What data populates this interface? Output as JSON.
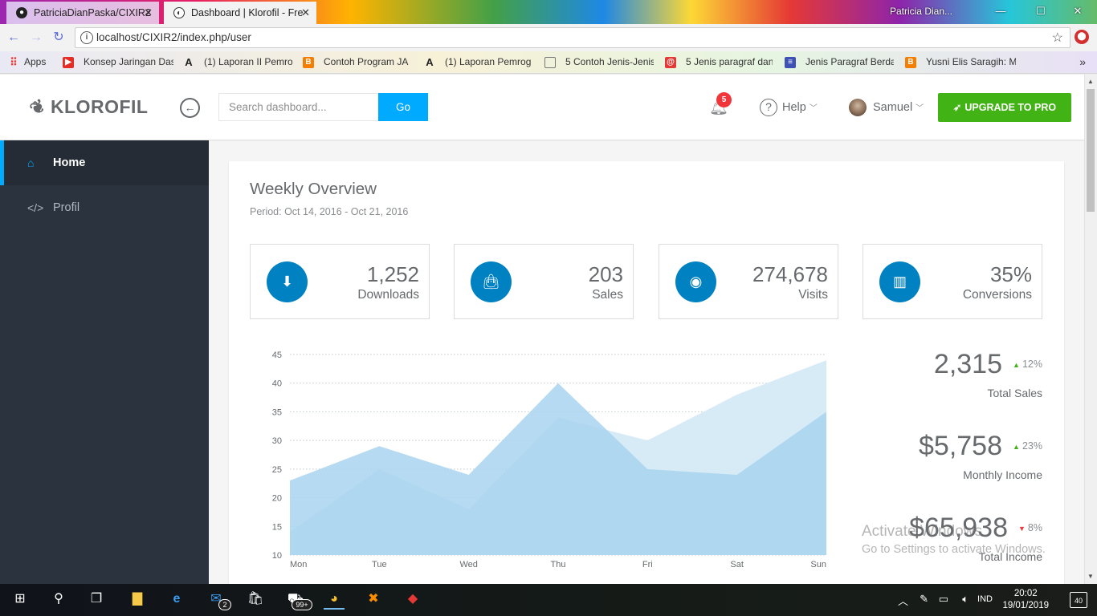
{
  "browser": {
    "tabs": [
      {
        "title": "PatriciaDianPaska/CIXIR2",
        "active": false
      },
      {
        "title": "Dashboard | Klorofil - Fre",
        "active": true
      }
    ],
    "profile_name": "Patricia Dian...",
    "url": "localhost/CIXIR2/index.php/user",
    "bookmarks": [
      {
        "label": "Apps",
        "icon": "apps-grid-icon",
        "color": "#e53935"
      },
      {
        "label": "Konsep Jaringan Das",
        "icon": "youtube-icon",
        "color": "#e52d27"
      },
      {
        "label": "(1) Laporan II Pemro",
        "icon": "a-letter-icon",
        "color": "#222222"
      },
      {
        "label": "Contoh Program JA",
        "icon": "blogger-icon",
        "color": "#f57d00"
      },
      {
        "label": "(1) Laporan Pemrog",
        "icon": "a-letter-icon",
        "color": "#222222"
      },
      {
        "label": "5 Contoh Jenis-Jenis",
        "icon": "page-icon",
        "color": "#9e9e9e"
      },
      {
        "label": "5 Jenis paragraf dan",
        "icon": "at-sign-icon",
        "color": "#e53935"
      },
      {
        "label": "Jenis Paragraf Berda",
        "icon": "document-icon",
        "color": "#3f51b5"
      },
      {
        "label": "Yusni Elis Saragih: M",
        "icon": "blogger-icon",
        "color": "#f57d00"
      }
    ]
  },
  "header": {
    "logo_text": "KLOROFIL",
    "search_placeholder": "Search dashboard...",
    "search_button": "Go",
    "notification_count": "5",
    "help_label": "Help",
    "user_name": "Samuel",
    "upgrade_label": "UPGRADE TO PRO"
  },
  "sidebar": {
    "items": [
      {
        "label": "Home",
        "icon": "home-icon",
        "active": true
      },
      {
        "label": "Profil",
        "icon": "code-icon",
        "active": false
      }
    ]
  },
  "panel": {
    "title": "Weekly Overview",
    "subtitle": "Period: Oct 14, 2016 - Oct 21, 2016",
    "metrics": [
      {
        "value": "1,252",
        "label": "Downloads",
        "icon": "download-icon"
      },
      {
        "value": "203",
        "label": "Sales",
        "icon": "shopping-bag-icon"
      },
      {
        "value": "274,678",
        "label": "Visits",
        "icon": "eye-icon"
      },
      {
        "value": "35%",
        "label": "Conversions",
        "icon": "bar-chart-icon"
      }
    ],
    "stats": [
      {
        "value": "2,315",
        "change": "12%",
        "direction": "up",
        "label": "Total Sales"
      },
      {
        "value": "$5,758",
        "change": "23%",
        "direction": "up",
        "label": "Monthly Income"
      },
      {
        "value": "$65,938",
        "change": "8%",
        "direction": "down",
        "label": "Total Income"
      }
    ]
  },
  "chart_data": {
    "type": "area",
    "categories": [
      "Mon",
      "Tue",
      "Wed",
      "Thu",
      "Fri",
      "Sat",
      "Sun"
    ],
    "ylim": [
      10,
      45
    ],
    "yticks": [
      10,
      15,
      20,
      25,
      30,
      35,
      40,
      45
    ],
    "series": [
      {
        "values": [
          14,
          25,
          18,
          34,
          30,
          38,
          44
        ],
        "color": "#d7ebf7"
      },
      {
        "values": [
          23,
          29,
          24,
          40,
          25,
          24,
          35
        ],
        "color": "#a9d4ee"
      }
    ]
  },
  "watermark": {
    "line1": "Activate Windows",
    "line2": "Go to Settings to activate Windows."
  },
  "taskbar": {
    "mail_badge": "2",
    "store_badge": "99+",
    "language": "IND",
    "time": "20:02",
    "date": "19/01/2019",
    "notifications": "40"
  }
}
